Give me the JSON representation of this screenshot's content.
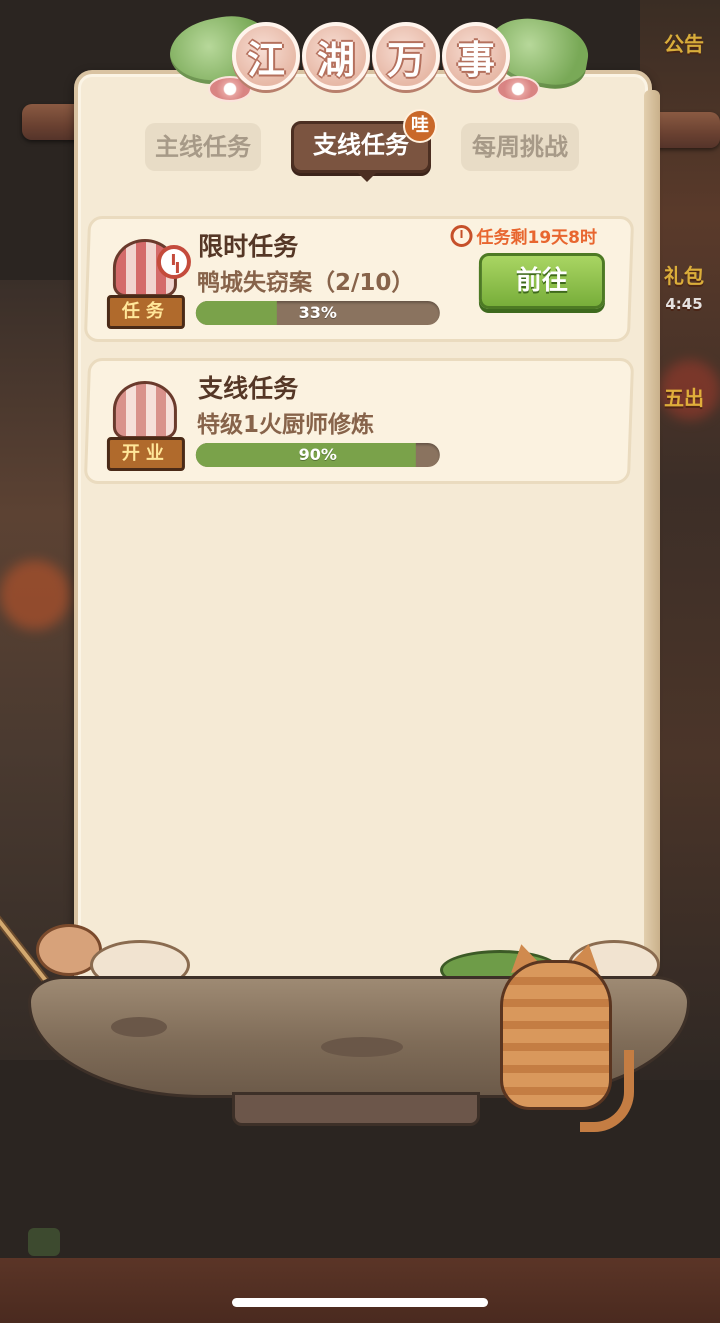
{
  "title": {
    "chars": [
      "江",
      "湖",
      "万",
      "事"
    ]
  },
  "tabs": [
    {
      "label": "主线任务",
      "active": false
    },
    {
      "label": "支线任务",
      "active": true,
      "badge": "哇"
    },
    {
      "label": "每周挑战",
      "active": false
    }
  ],
  "tasks": [
    {
      "title": "限时任务",
      "subtitle": "鸭城失窃案（2/10）",
      "progress": 0.33,
      "progress_label": "33%",
      "icon": "task-tent-icon",
      "sign_label": "任务",
      "timer_label": "任务剩19天8时",
      "timer_icon": "alarm-clock-icon",
      "action_label": "前往"
    },
    {
      "title": "支线任务",
      "subtitle": "特级1火厨师修炼",
      "progress": 0.9,
      "progress_label": "90%",
      "icon": "business-tent-icon",
      "sign_label": "开业"
    }
  ],
  "background": {
    "side_labels": [
      "公告",
      "礼包",
      "4:45",
      "五出"
    ]
  },
  "colors": {
    "active_tab": "#7b5440",
    "progress_fill": "#7aa24a",
    "go_button": "#78ae3a",
    "timer_text": "#e8662f"
  }
}
